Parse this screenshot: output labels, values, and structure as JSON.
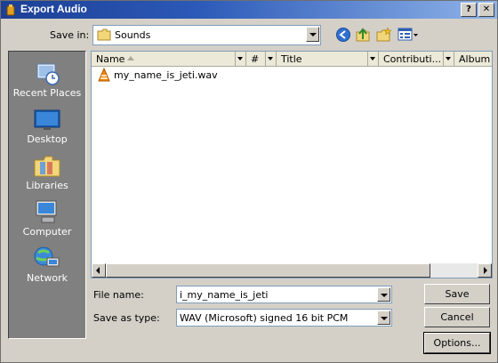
{
  "window": {
    "title": "Export Audio",
    "help_symbol": "?",
    "close_symbol": "✕"
  },
  "savein": {
    "label": "Save in:",
    "value": "Sounds"
  },
  "toolbar": [
    "back-icon",
    "up-folder-icon",
    "new-folder-icon",
    "view-menu-icon"
  ],
  "places": [
    {
      "label": "Recent Places",
      "icon": "recent-places-icon"
    },
    {
      "label": "Desktop",
      "icon": "desktop-icon"
    },
    {
      "label": "Libraries",
      "icon": "libraries-icon"
    },
    {
      "label": "Computer",
      "icon": "computer-icon"
    },
    {
      "label": "Network",
      "icon": "network-icon"
    }
  ],
  "columns": [
    "Name",
    "#",
    "Title",
    "Contributi...",
    "Album"
  ],
  "files": [
    {
      "name": "my_name_is_jeti.wav",
      "icon": "vlc-file-icon"
    }
  ],
  "filename": {
    "label": "File name:",
    "value": "i_my_name_is_jeti"
  },
  "filetype": {
    "label": "Save as type:",
    "value": "WAV (Microsoft) signed 16 bit PCM"
  },
  "buttons": {
    "save": "Save",
    "cancel": "Cancel",
    "options": "Options..."
  },
  "colors": {
    "titlebar": "#1c3f95",
    "places_bg": "#808080",
    "dialog_bg": "#d4d0c8"
  }
}
